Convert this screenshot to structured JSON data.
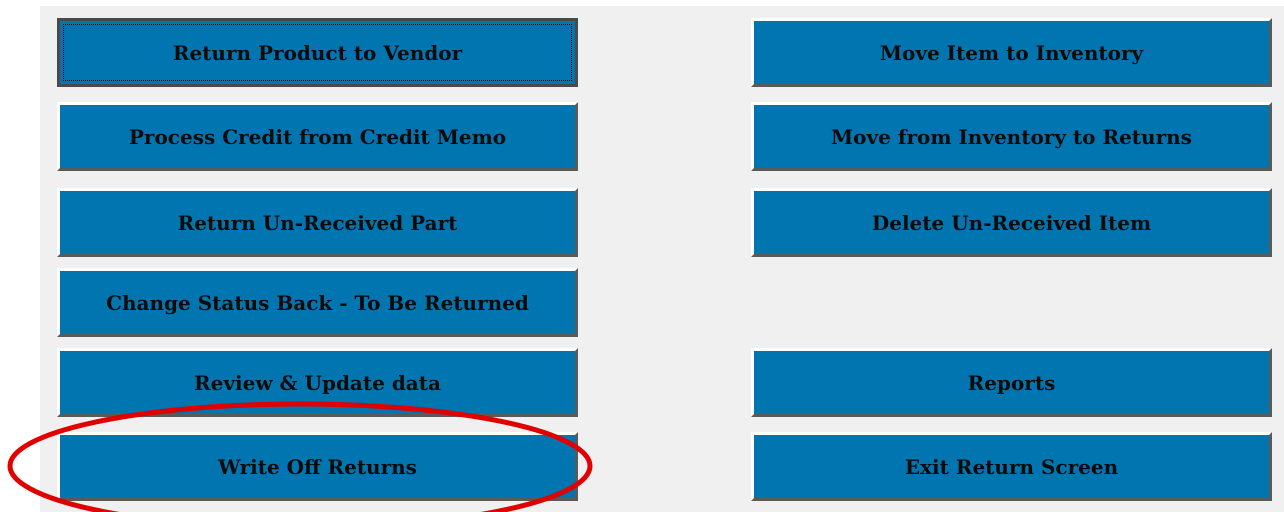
{
  "buttons": {
    "return_product_to_vendor": "Return Product to Vendor",
    "process_credit_from_credit_memo": "Process Credit from Credit Memo",
    "return_un_received_part": "Return Un-Received Part",
    "change_status_back": "Change Status Back - To Be Returned",
    "review_update_data": "Review & Update data",
    "write_off_returns": "Write Off Returns",
    "move_item_to_inventory": "Move Item to Inventory",
    "move_from_inventory_to_returns": "Move from Inventory to Returns",
    "delete_un_received_item": "Delete Un-Received Item",
    "reports": "Reports",
    "exit_return_screen": "Exit Return Screen"
  },
  "colors": {
    "button_fill": "#0075b0",
    "panel_background": "#f0f0f0",
    "annotation_ring": "#e00000"
  },
  "annotation": {
    "shape": "ellipse",
    "highlights": "write_off_returns"
  }
}
